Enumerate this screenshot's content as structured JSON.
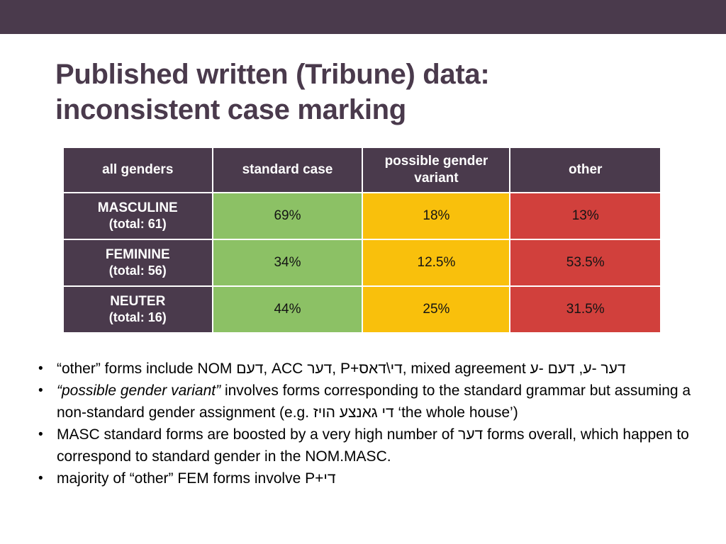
{
  "slide": {
    "title_lines": [
      "Published written (Tribune) data:",
      "inconsistent case marking"
    ],
    "colors": {
      "banner": "#4a3a4c",
      "header": "#4a3a4c",
      "title": "#4a3a4c",
      "green": "#8cc165",
      "yellow": "#f9c00c",
      "red": "#d1403c",
      "body_text": "#000000"
    }
  },
  "table": {
    "headers": [
      "all genders",
      "standard case",
      "possible gender variant",
      "other"
    ],
    "rows": [
      {
        "label": "MASCULINE",
        "sub": "(total: 61)",
        "standard_case": "69%",
        "possible_gender_variant": "18%",
        "other": "13%"
      },
      {
        "label": "FEMININE",
        "sub": "(total: 56)",
        "standard_case": "34%",
        "possible_gender_variant": "12.5%",
        "other": "53.5%"
      },
      {
        "label": "NEUTER",
        "sub": "(total: 16)",
        "standard_case": "44%",
        "possible_gender_variant": "25%",
        "other": "31.5%"
      }
    ]
  },
  "bullets": [
    {
      "id": "bullet-other-forms",
      "marker": "•",
      "parts": [
        {
          "text": "“other” forms include NOM דעם, ACC דער, P+די\\דאס, mixed agreement דער -ע, דעם -ע",
          "italic": false
        }
      ]
    },
    {
      "id": "bullet-possible-gender-variant",
      "marker": "•",
      "parts": [
        {
          "text": "“possible gender variant”",
          "italic": true
        },
        {
          "text": " involves forms corresponding to the standard grammar but assuming a non-standard gender assignment (e.g. די גאנצע הויז ‘the whole house’)",
          "italic": false
        }
      ]
    },
    {
      "id": "bullet-masc-standard-forms",
      "marker": "•",
      "parts": [
        {
          "text": "MASC standard forms are boosted by a very high number of דער forms overall, which happen to correspond to standard gender in the NOM.MASC.",
          "italic": false
        }
      ]
    },
    {
      "id": "bullet-majority-fem",
      "marker": "•",
      "parts": [
        {
          "text": "majority of “other” FEM forms involve P+די",
          "italic": false
        }
      ]
    }
  ]
}
